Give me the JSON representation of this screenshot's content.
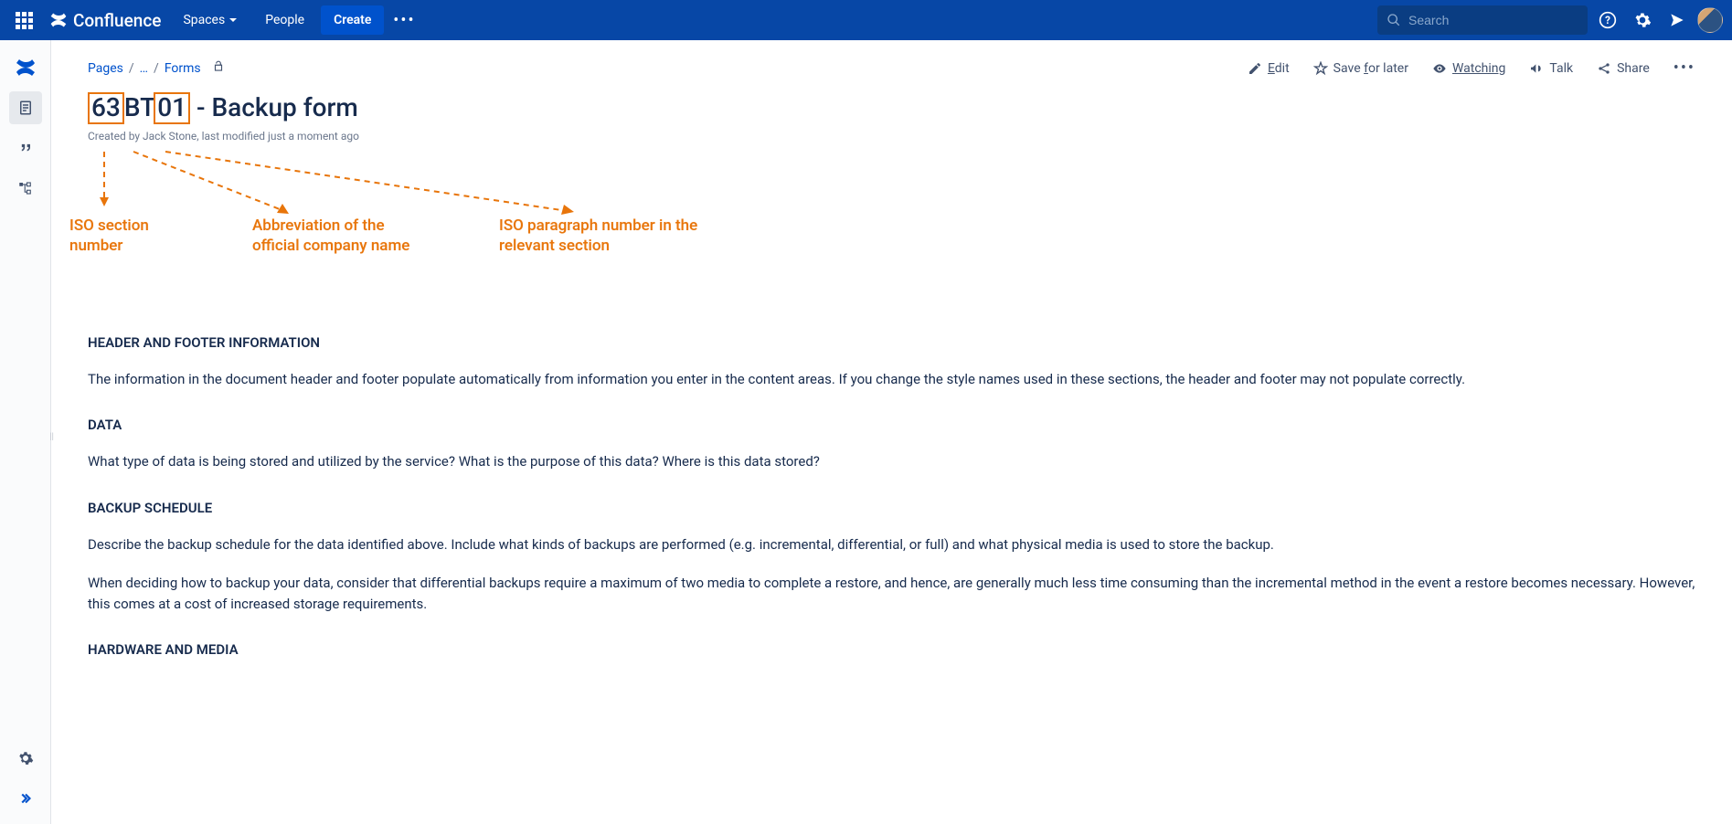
{
  "nav": {
    "product": "Confluence",
    "spaces": "Spaces",
    "people": "People",
    "create": "Create",
    "search_placeholder": "Search"
  },
  "breadcrumbs": {
    "pages": "Pages",
    "ellipsis": "…",
    "forms": "Forms"
  },
  "actions": {
    "edit": "Edit",
    "save": "Save for later",
    "watching": "Watching",
    "talk": "Talk",
    "share": "Share"
  },
  "title": {
    "part1": "63",
    "part2": "BT",
    "part3": "01",
    "rest": " - Backup form",
    "byline": "Created by Jack Stone, last modified just a moment ago"
  },
  "annotations": {
    "a1": "ISO section number",
    "a2": "Abbreviation of the official company name",
    "a3": "ISO paragraph number in the relevant section"
  },
  "content": {
    "h1": "HEADER AND FOOTER INFORMATION",
    "p1": "The information in the document header and footer populate automatically from information you enter in the content areas. If you change the style names used in these sections, the header and footer may not populate correctly.",
    "h2": "DATA",
    "p2": "What type of data is being stored and utilized by the service? What is the purpose of this data? Where is this data stored?",
    "h3": "BACKUP SCHEDULE",
    "p3": "Describe the backup schedule for the data identified above. Include what kinds of backups are performed (e.g. incremental, differential, or full) and what physical media is used to store the backup.",
    "p4": "When deciding how to backup your data, consider that differential backups require a maximum of two media to complete a restore, and hence, are generally much less time consuming than the incremental method in the event a restore becomes necessary. However, this comes at a cost of increased storage requirements.",
    "h4": "HARDWARE AND MEDIA"
  }
}
